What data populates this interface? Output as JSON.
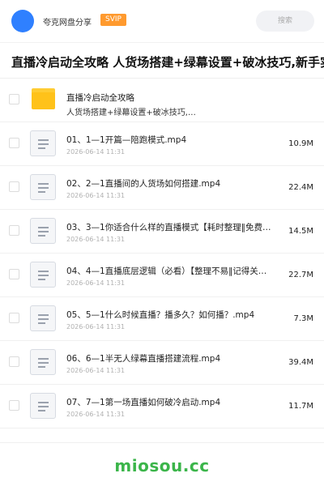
{
  "header": {
    "brand_name": "夸克网盘分享",
    "badge": "SVIP",
    "search_placeholder": "搜索"
  },
  "share": {
    "title": "直播冷启动全攻略 人货场搭建+绿幕设置+破冰技巧,新手实"
  },
  "folder": {
    "name": "直播冷启动全攻略",
    "subtitle": "人货场搭建+绿幕设置+破冰技巧,…"
  },
  "files": [
    {
      "name": "01、1—1开篇—陪跑模式.mp4",
      "date": "2026-06-14 11:31",
      "size": "10.9M"
    },
    {
      "name": "02、2—1直播间的人货场如何搭建.mp4",
      "date": "2026-06-14 11:31",
      "size": "22.4M"
    },
    {
      "name": "03、3—1你适合什么样的直播模式【耗时整理‖免费…",
      "date": "2026-06-14 11:31",
      "size": "14.5M"
    },
    {
      "name": "04、4—1直播底层逻辑（必看）【整理不易‖记得关…",
      "date": "2026-06-14 11:31",
      "size": "22.7M"
    },
    {
      "name": "05、5—1什么时候直播？播多久？如何播？.mp4",
      "date": "2026-06-14 11:31",
      "size": "7.3M"
    },
    {
      "name": "06、6—1半无人绿幕直播搭建流程.mp4",
      "date": "2026-06-14 11:31",
      "size": "39.4M"
    },
    {
      "name": "07、7—1第一场直播如何破冷启动.mp4",
      "date": "2026-06-14 11:31",
      "size": "11.7M"
    }
  ],
  "watermark": "miosou.cc",
  "icons": {
    "avatar": "avatar-circle",
    "folder": "folder-icon",
    "file": "document-icon",
    "checkbox": "checkbox-empty"
  },
  "colors": {
    "avatar": "#2f80ff",
    "badge": "#ff9a2e",
    "folder": "#ffc21a",
    "watermark": "#3bb54a"
  }
}
